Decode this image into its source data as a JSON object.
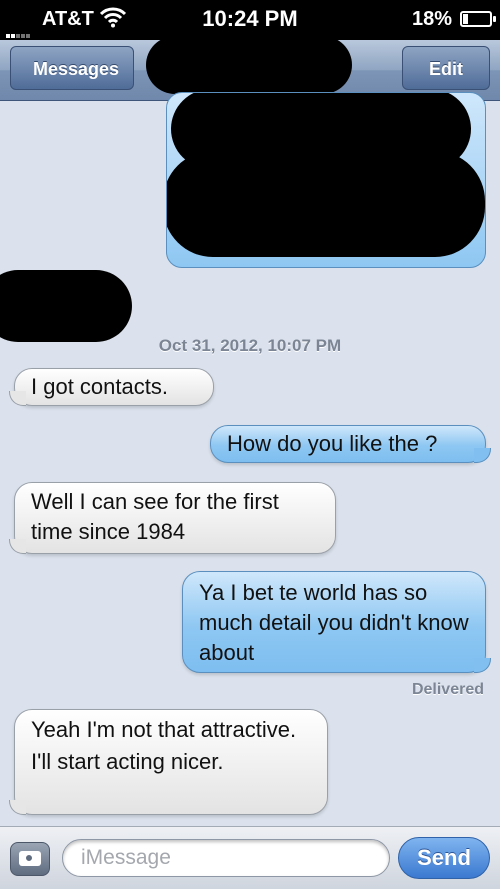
{
  "status_bar": {
    "carrier": "AT&T",
    "time": "10:24 PM",
    "battery_percent": "18%",
    "battery_level": 0.18,
    "icons": [
      "signal-icon",
      "wifi-icon",
      "battery-icon"
    ]
  },
  "nav": {
    "back_label": "Messages",
    "edit_label": "Edit"
  },
  "conversation": {
    "timestamp": "Oct 31, 2012, 10:07 PM",
    "messages": [
      {
        "from": "them",
        "text": "I got contacts."
      },
      {
        "from": "me",
        "text": "How do you like the ?"
      },
      {
        "from": "them",
        "text": "Well I can see for the first time since 1984"
      },
      {
        "from": "me",
        "text": "Ya I bet te world has so much detail you didn't know about"
      },
      {
        "from": "them",
        "text": "Yeah I'm not that attractive. I'll start acting nicer."
      }
    ],
    "delivered_label": "Delivered"
  },
  "composer": {
    "placeholder": "iMessage",
    "send_label": "Send"
  },
  "colors": {
    "incoming_bubble": "#e3e3e3",
    "outgoing_bubble": "#8ec7f2",
    "background": "#dbe2ed",
    "send_button": "#3b79d0"
  }
}
